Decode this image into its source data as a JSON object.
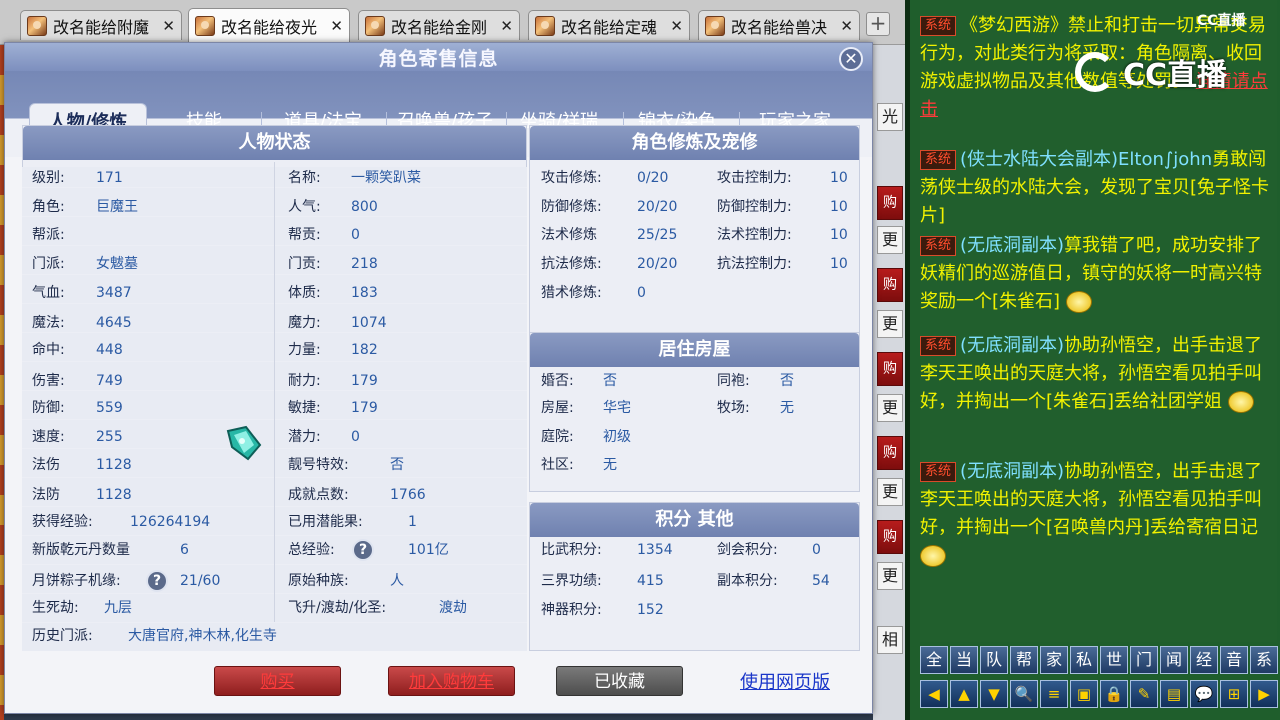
{
  "browser": {
    "tabs": [
      {
        "title": "改名能给附魔",
        "close": "✕"
      },
      {
        "title": "改名能给夜光",
        "close": "✕"
      },
      {
        "title": "改名能给金刚",
        "close": "✕"
      },
      {
        "title": "改名能给定魂",
        "close": "✕"
      },
      {
        "title": "改名能给兽决",
        "close": "✕"
      }
    ],
    "new_tab": "+"
  },
  "dialog": {
    "title": "角色寄售信息",
    "close": "✕",
    "tabs": [
      "人物/修炼",
      "技能",
      "道具/法宝",
      "召唤兽/孩子",
      "坐骑/祥瑞",
      "锦衣/染色",
      "玩家之家"
    ],
    "active_tab": "人物/修炼"
  },
  "status": {
    "title": "人物状态",
    "left": [
      {
        "label": "级别:",
        "value": "171"
      },
      {
        "label": "角色:",
        "value": "巨魔王"
      },
      {
        "label": "帮派:",
        "value": ""
      },
      {
        "label": "门派:",
        "value": "女魃墓"
      },
      {
        "label": "气血:",
        "value": "3487"
      },
      {
        "label": "魔法:",
        "value": "4645"
      },
      {
        "label": "命中:",
        "value": "448"
      },
      {
        "label": "伤害:",
        "value": "749"
      },
      {
        "label": "防御:",
        "value": "559"
      },
      {
        "label": "速度:",
        "value": "255"
      },
      {
        "label": "法伤",
        "value": "1128"
      },
      {
        "label": "法防",
        "value": "1128"
      },
      {
        "label": "获得经验:",
        "value": "126264194"
      },
      {
        "label": "新版乾元丹数量",
        "value": "6"
      },
      {
        "label": "月饼粽子机缘:",
        "value": "21/60"
      },
      {
        "label": "生死劫:",
        "value": "九层"
      },
      {
        "label": "历史门派:",
        "value": "大唐官府,神木林,化生寺"
      }
    ],
    "right": [
      {
        "label": "名称:",
        "value": "一颗笑趴菜"
      },
      {
        "label": "人气:",
        "value": "800"
      },
      {
        "label": "帮贡:",
        "value": "0"
      },
      {
        "label": "门贡:",
        "value": "218"
      },
      {
        "label": "体质:",
        "value": "183"
      },
      {
        "label": "魔力:",
        "value": "1074"
      },
      {
        "label": "力量:",
        "value": "182"
      },
      {
        "label": "耐力:",
        "value": "179"
      },
      {
        "label": "敏捷:",
        "value": "179"
      },
      {
        "label": "潜力:",
        "value": "0"
      },
      {
        "label": "靓号特效:",
        "value": "否"
      },
      {
        "label": "成就点数:",
        "value": "1766"
      },
      {
        "label": "已用潜能果:",
        "value": "1"
      },
      {
        "label": "总经验:",
        "value": "101亿"
      },
      {
        "label": "原始种族:",
        "value": "人"
      },
      {
        "label": "飞升/渡劫/化圣:",
        "value": "渡劫"
      }
    ],
    "help": "?"
  },
  "cultivation": {
    "title": "角色修炼及宠修",
    "left": [
      {
        "label": "攻击修炼:",
        "value": "0/20"
      },
      {
        "label": "防御修炼:",
        "value": "20/20"
      },
      {
        "label": "法术修炼",
        "value": "25/25"
      },
      {
        "label": "抗法修炼:",
        "value": "20/20"
      },
      {
        "label": "猎术修炼:",
        "value": "0"
      }
    ],
    "right": [
      {
        "label": "攻击控制力:",
        "value": "10"
      },
      {
        "label": "防御控制力:",
        "value": "10"
      },
      {
        "label": "法术控制力:",
        "value": "10"
      },
      {
        "label": "抗法控制力:",
        "value": "10"
      }
    ]
  },
  "house": {
    "title": "居住房屋",
    "rows": [
      {
        "label": "婚否:",
        "value": "否",
        "label2": "同袍:",
        "value2": "否"
      },
      {
        "label": "房屋:",
        "value": "华宅",
        "label2": "牧场:",
        "value2": "无"
      },
      {
        "label": "庭院:",
        "value": "初级"
      },
      {
        "label": "社区:",
        "value": "无"
      }
    ]
  },
  "points": {
    "title": "积分 其他",
    "rows": [
      {
        "label": "比武积分:",
        "value": "1354",
        "label2": "剑会积分:",
        "value2": "0"
      },
      {
        "label": "三界功绩:",
        "value": "415",
        "label2": "副本积分:",
        "value2": "54"
      },
      {
        "label": "神器积分:",
        "value": "152"
      }
    ]
  },
  "buttons": {
    "buy": "购买",
    "cart": "加入购物车",
    "fav": "已收藏",
    "web": "使用网页版"
  },
  "side_buttons": [
    "光",
    "购",
    "更",
    "购",
    "更",
    "购",
    "更",
    "购",
    "更",
    "购",
    "更",
    "相"
  ],
  "chat": {
    "sys_tag": "系统",
    "messages": [
      {
        "lines": [
          "《梦幻西游》禁止和打击一切异常交易行为，对此类行为将采取：角色隔离、收回游戏虚拟物品及其他数值等处罚。"
        ],
        "link": "详情请点击"
      },
      {
        "prefix": "(侠士水陆大会副本)Elton∫john",
        "text": "勇敢闯荡侠士级的水陆大会，发现了宝贝[兔子怪卡片]"
      },
      {
        "prefix": "(无底洞副本)",
        "text": "算我错了吧，成功安排了妖精们的巡游值日，镇守的妖将一时高兴特奖励一个[朱雀石]"
      },
      {
        "prefix": "(无底洞副本)",
        "text": "协助孙悟空，出手击退了李天王唤出的天庭大将，孙悟空看见拍手叫好，并掏出一个[朱雀石]丢给社团学姐"
      },
      {
        "prefix": "(无底洞副本)",
        "text": "协助孙悟空，出手击退了李天王唤出的天庭大将，孙悟空看见拍手叫好，并掏出一个[召唤兽内丹]丢给寄宿日记"
      }
    ],
    "channels": [
      "全",
      "当",
      "队",
      "帮",
      "家",
      "私",
      "世",
      "门",
      "闻",
      "经",
      "音",
      "系"
    ],
    "icons": [
      "◀",
      "▲",
      "▼",
      "🔍",
      "≡",
      "▣",
      "🔒",
      "✎",
      "▤",
      "💬",
      "⊞",
      "▶"
    ]
  },
  "watermark": {
    "logo_text": "CC直播",
    "corner_text": "CC直播"
  }
}
